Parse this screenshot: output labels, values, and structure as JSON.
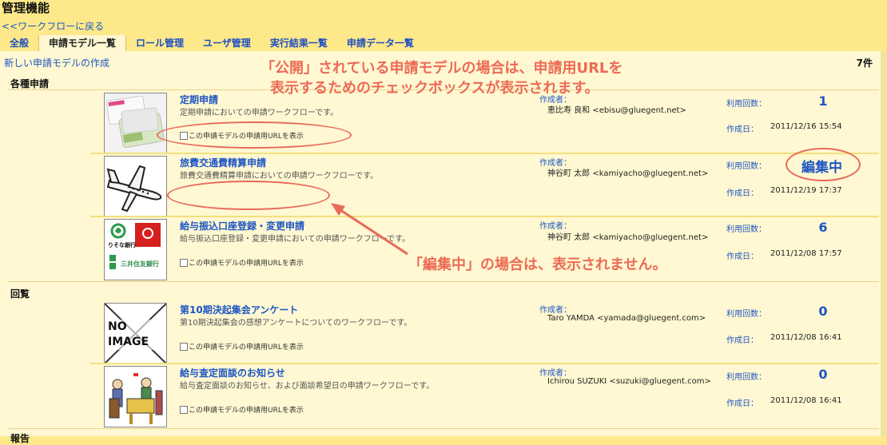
{
  "header": {
    "title": "管理機能",
    "back_link": "<<ワークフローに戻る",
    "tabs": [
      {
        "label": "全般",
        "active": false
      },
      {
        "label": "申請モデル一覧",
        "active": true
      },
      {
        "label": "ロール管理",
        "active": false
      },
      {
        "label": "ユーザ管理",
        "active": false
      },
      {
        "label": "実行結果一覧",
        "active": false
      },
      {
        "label": "申請データ一覧",
        "active": false
      }
    ]
  },
  "toolbar": {
    "new_model": "新しい申請モデルの作成",
    "count": "7件"
  },
  "labels": {
    "author": "作成者：",
    "uses": "利用回数：",
    "created": "作成日：",
    "checkbox": "この申請モデルの申請用URLを表示",
    "editing": "編集中",
    "no_image": "NO IMAGE"
  },
  "categories": [
    {
      "name": "各種申請"
    },
    {
      "name": "回覧"
    },
    {
      "name": "報告"
    }
  ],
  "models": [
    {
      "name": "定期申請",
      "desc": "定期申請においての申請ワークフローです。",
      "author": "恵比寿 良和 <ebisu@gluegent.net>",
      "uses": "1",
      "created": "2011/12/16 15:54",
      "thumb": "card-image"
    },
    {
      "name": "旅費交通費精算申請",
      "desc": "旅費交通費精算申請においての申請ワークフローです。",
      "author": "神谷町 太郎 <kamiyacho@gluegent.net>",
      "uses": "",
      "created": "2011/12/19 17:37",
      "thumb": "airplane-image"
    },
    {
      "name": "給与振込口座登録・変更申請",
      "desc": "給与振込口座登録・変更申請においての申請ワークフローです。",
      "author": "神谷町 太郎 <kamiyacho@gluegent.net>",
      "uses": "6",
      "created": "2011/12/08 17:57",
      "thumb": "bank-logos-image",
      "banks": [
        "りそな銀行",
        "三井住友銀行"
      ]
    },
    {
      "name": "第10期決起集会アンケート",
      "desc": "第10期決起集会の感想アンケートについてのワークフローです。",
      "author": "Taro YAMDA <yamada@gluegent.com>",
      "uses": "0",
      "created": "2011/12/08 16:41",
      "thumb": "no-image"
    },
    {
      "name": "給与査定面談のお知らせ",
      "desc": "給与査定面談のお知らせ、および面談希望日の申請ワークフローです。",
      "author": "Ichirou SUZUKI <suzuki@gluegent.com>",
      "uses": "0",
      "created": "2011/12/08 16:41",
      "thumb": "interview-image"
    }
  ],
  "annotations": {
    "top_line1": "「公開」されている申請モデルの場合は、申請用URLを",
    "top_line2": "表示するためのチェックボックスが表示されます。",
    "middle": "「編集中」の場合は、表示されません。"
  },
  "colors": {
    "accent": "#1f56c4",
    "callout": "#ec6a55",
    "background": "#fff8d2",
    "header": "#fde98a"
  }
}
